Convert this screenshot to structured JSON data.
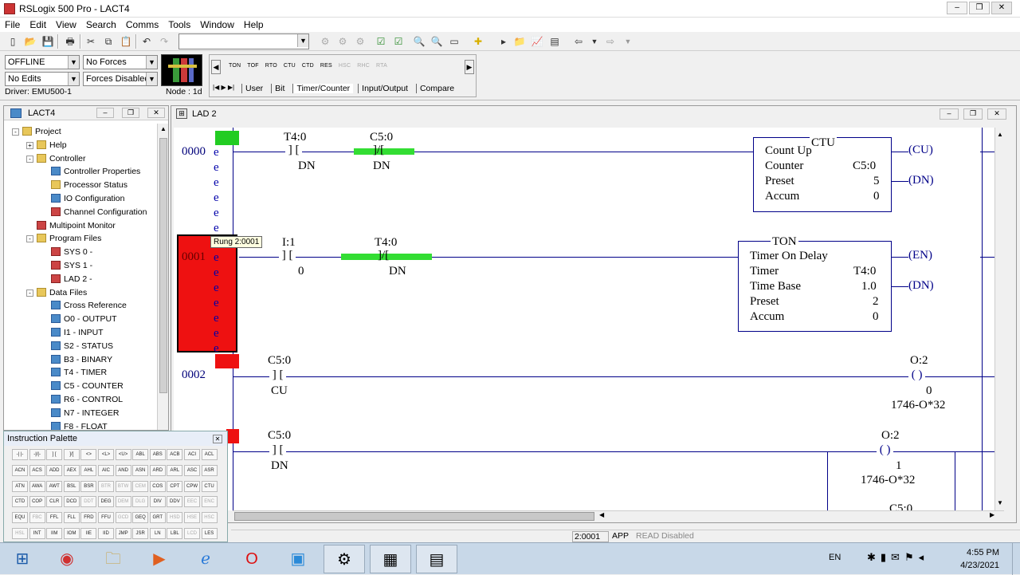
{
  "window": {
    "title": "RSLogix 500 Pro - LACT4"
  },
  "menu": [
    "File",
    "Edit",
    "View",
    "Search",
    "Comms",
    "Tools",
    "Window",
    "Help"
  ],
  "status": {
    "mode": "OFFLINE",
    "forces": "No Forces",
    "edits": "No Edits",
    "forces_enabled": "Forces Disabled",
    "driver": "Driver: EMU500-1",
    "node": "Node :  1d"
  },
  "instr_bar": {
    "items": [
      "TON",
      "TOF",
      "RTO",
      "CTU",
      "CTD",
      "RES",
      "HSC",
      "RHC",
      "RTA"
    ],
    "tabs": [
      "User",
      "Bit",
      "Timer/Counter",
      "Input/Output",
      "Compare"
    ],
    "active_tab": "Timer/Counter"
  },
  "project": {
    "title": "LACT4",
    "items": [
      {
        "label": "Project",
        "indent": 0,
        "icon": "folder",
        "exp": "-"
      },
      {
        "label": "Help",
        "indent": 1,
        "icon": "folder",
        "exp": "+"
      },
      {
        "label": "Controller",
        "indent": 1,
        "icon": "folder",
        "exp": "-"
      },
      {
        "label": "Controller Properties",
        "indent": 2,
        "icon": "info"
      },
      {
        "label": "Processor Status",
        "indent": 2,
        "icon": "pencil"
      },
      {
        "label": "IO Configuration",
        "indent": 2,
        "icon": "io"
      },
      {
        "label": "Channel Configuration",
        "indent": 2,
        "icon": "channel"
      },
      {
        "label": "Multipoint Monitor",
        "indent": 1,
        "icon": "prog"
      },
      {
        "label": "Program Files",
        "indent": 1,
        "icon": "folder",
        "exp": "-"
      },
      {
        "label": "SYS 0 -",
        "indent": 2,
        "icon": "prog"
      },
      {
        "label": "SYS 1 -",
        "indent": 2,
        "icon": "prog"
      },
      {
        "label": "LAD 2 -",
        "indent": 2,
        "icon": "ladder"
      },
      {
        "label": "Data Files",
        "indent": 1,
        "icon": "folder",
        "exp": "-"
      },
      {
        "label": "Cross Reference",
        "indent": 2,
        "icon": "xref"
      },
      {
        "label": "O0 - OUTPUT",
        "indent": 2,
        "icon": "file"
      },
      {
        "label": "I1 - INPUT",
        "indent": 2,
        "icon": "file"
      },
      {
        "label": "S2 - STATUS",
        "indent": 2,
        "icon": "file"
      },
      {
        "label": "B3 - BINARY",
        "indent": 2,
        "icon": "file"
      },
      {
        "label": "T4 - TIMER",
        "indent": 2,
        "icon": "file"
      },
      {
        "label": "C5 - COUNTER",
        "indent": 2,
        "icon": "file"
      },
      {
        "label": "R6 - CONTROL",
        "indent": 2,
        "icon": "file"
      },
      {
        "label": "N7 - INTEGER",
        "indent": 2,
        "icon": "file"
      },
      {
        "label": "F8 - FLOAT",
        "indent": 2,
        "icon": "file"
      }
    ]
  },
  "palette": {
    "title": "Instruction Palette",
    "rows": [
      [
        "-| |-",
        "-|/|-",
        "] [",
        "]/[",
        "<>",
        "<L>",
        "<U>",
        "ABL",
        "ABS",
        "ACB",
        "ACI",
        "ACL"
      ],
      [
        "ACN",
        "ACS",
        "ADD",
        "AEX",
        "AHL",
        "AIC",
        "AND",
        "ASN",
        "ARD",
        "ARL",
        "ASC",
        "ASR"
      ],
      [
        "ATN",
        "AWA",
        "AWT",
        "BSL",
        "BSR",
        "BTR",
        "BTW",
        "CEM",
        "COS",
        "CPT",
        "CPW",
        "CTU"
      ],
      [
        "CTD",
        "COP",
        "CLR",
        "DCD",
        "DDT",
        "DEG",
        "DEM",
        "DLG",
        "DIV",
        "DDV",
        "EEC",
        "ENC"
      ],
      [
        "EQU",
        "FBC",
        "FFL",
        "FLL",
        "FRD",
        "FFU",
        "GCD",
        "GEQ",
        "GRT",
        "HSD",
        "HSE",
        "HSC"
      ],
      [
        "HSL",
        "INT",
        "IIM",
        "IOM",
        "IIE",
        "IID",
        "JMP",
        "JSR",
        "LN",
        "LBL",
        "LCD",
        "LES"
      ]
    ],
    "disabled": [
      "BTR",
      "BTW",
      "CEM",
      "DDT",
      "DEM",
      "DLG",
      "EEC",
      "ENC",
      "FBC",
      "GCD",
      "HSD",
      "HSE",
      "HSC",
      "HSL",
      "LCD"
    ]
  },
  "ladder": {
    "title": "LAD 2",
    "rung0": {
      "num": "0000",
      "c1_addr": "T4:0",
      "c1_bit": "DN",
      "c2_addr": "C5:0",
      "c2_bit": "DN",
      "box_title": "CTU",
      "box_desc": "Count Up",
      "rows": [
        [
          "Counter",
          "C5:0"
        ],
        [
          "Preset",
          "5"
        ],
        [
          "Accum",
          "0"
        ]
      ],
      "out1": "CU",
      "out2": "DN"
    },
    "tooltip": "Rung 2:0001",
    "rung1": {
      "num": "0001",
      "c1_addr": "I:1",
      "c1_bit": "0",
      "c2_addr": "T4:0",
      "c2_bit": "DN",
      "box_title": "TON",
      "box_desc": "Timer On Delay",
      "rows": [
        [
          "Timer",
          "T4:0"
        ],
        [
          "Time Base",
          "1.0"
        ],
        [
          "Preset",
          "2"
        ],
        [
          "Accum",
          "0"
        ]
      ],
      "out1": "EN",
      "out2": "DN"
    },
    "rung2": {
      "num": "0002",
      "c1_addr": "C5:0",
      "c1_bit": "CU",
      "coil_addr": "O:2",
      "coil_bit": "0",
      "coil_desc": "1746-O*32"
    },
    "rung3": {
      "c1_addr": "C5:0",
      "c1_bit": "DN",
      "coil_addr": "O:2",
      "coil_bit": "1",
      "coil_desc": "1746-O*32",
      "next": "C5:0"
    },
    "e": "e"
  },
  "statusbar": {
    "pos": "2:0001",
    "app": "APP",
    "read": "READ",
    "disabled": "Disabled"
  },
  "clock": {
    "time": "4:55 PM",
    "date": "4/23/2021",
    "lang": "EN"
  }
}
